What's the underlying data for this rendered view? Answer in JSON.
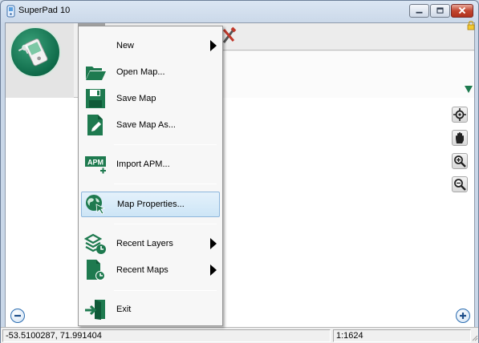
{
  "window": {
    "title": "SuperPad 10",
    "app_icon": "superpad-app-icon",
    "controls": {
      "minimize_icon": "minimize-icon",
      "maximize_icon": "maximize-icon",
      "close_icon": "close-icon"
    }
  },
  "toolbar": {
    "logo_icon": "gps-handheld-logo",
    "tools_icon": "tools-icon",
    "lock_icon": "lock-icon",
    "dropdown_icon": "dropdown-arrow-icon"
  },
  "menu": {
    "items": [
      {
        "label": "New",
        "icon": "new-icon",
        "submenu": true
      },
      {
        "label": "Open Map...",
        "icon": "folder-open-icon",
        "submenu": false
      },
      {
        "label": "Save Map",
        "icon": "floppy-disk-icon",
        "submenu": false
      },
      {
        "label": "Save Map As...",
        "icon": "save-as-icon",
        "submenu": false
      },
      {
        "label": "Import APM...",
        "icon": "import-apm-icon",
        "submenu": false
      },
      {
        "label": "Map Properties...",
        "icon": "globe-pointer-icon",
        "submenu": false,
        "highlighted": true
      },
      {
        "label": "Recent Layers",
        "icon": "recent-layers-icon",
        "submenu": true
      },
      {
        "label": "Recent Maps",
        "icon": "recent-maps-icon",
        "submenu": true
      },
      {
        "label": "Exit",
        "icon": "exit-door-icon",
        "submenu": false
      }
    ],
    "apm_icon_text": "APM"
  },
  "map_controls": {
    "locate_icon": "locate-crosshair-icon",
    "pan_icon": "hand-pan-icon",
    "zoom_in_icon": "zoom-in-icon",
    "zoom_out_icon": "zoom-out-icon",
    "minus_icon": "minus-circle-icon",
    "plus_icon": "plus-circle-icon"
  },
  "statusbar": {
    "coordinates": "-53.5100287, 71.991404",
    "scale": "1:1624"
  },
  "colors": {
    "accent_green": "#1e7a4f",
    "highlight_border": "#8db6dc",
    "close_red": "#c2452f"
  }
}
